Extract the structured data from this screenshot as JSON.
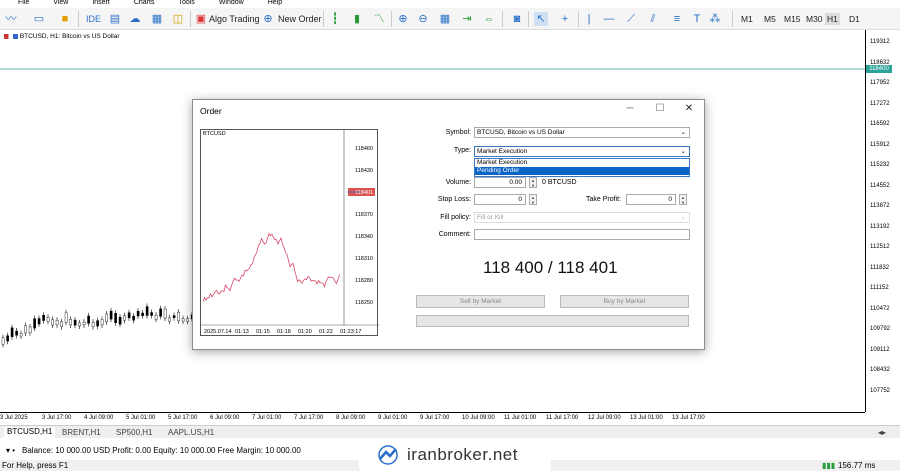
{
  "menu": [
    "File",
    "View",
    "Insert",
    "Charts",
    "Tools",
    "Window",
    "Help"
  ],
  "toolbar": {
    "algo_trading": "Algo Trading",
    "new_order": "New Order",
    "ide": "IDE",
    "timeframes": [
      "M1",
      "M5",
      "M15",
      "M30",
      "H1",
      "D1"
    ],
    "active_timeframe": "H1"
  },
  "chart": {
    "title": "BTCUSD, H1: Bitcoin vs US Dollar",
    "current_price": "118400",
    "price_ticks": [
      "119312",
      "118632",
      "117952",
      "117272",
      "116592",
      "115912",
      "115232",
      "114552",
      "113872",
      "113192",
      "112512",
      "111832",
      "111152",
      "110472",
      "109792",
      "109112",
      "108432",
      "107752"
    ],
    "time_ticks": [
      "3 Jul 2025",
      "3 Jul 17:00",
      "4 Jul 09:00",
      "5 Jul 01:00",
      "5 Jul 17:00",
      "6 Jul 09:00",
      "7 Jul 01:00",
      "7 Jul 17:00",
      "8 Jul 09:00",
      "9 Jul 01:00",
      "9 Jul 17:00",
      "10 Jul 09:00",
      "11 Jul 01:00",
      "11 Jul 17:00",
      "12 Jul 09:00",
      "13 Jul 01:00",
      "13 Jul 17:00"
    ]
  },
  "symbol_tabs": [
    "BTCUSD,H1",
    "BRENT,H1",
    "SP500,H1",
    "AAPL.US,H1"
  ],
  "status": {
    "account": "Balance: 10 000.00 USD  Profit: 0.00  Equity: 10 000.00  Free Margin: 10 000.00",
    "help": "For Help, press F1",
    "ping": "156.77 ms"
  },
  "watermark": "iranbroker.net",
  "order_dialog": {
    "title": "Order",
    "mini_chart": {
      "symbol": "BTCUSD",
      "price_ticks": [
        "118460",
        "118430",
        "118401",
        "118370",
        "118340",
        "118310",
        "118280",
        "118250"
      ],
      "time_ticks": [
        "2025.07.14",
        "01:13",
        "01:15",
        "01:18",
        "01:20",
        "01:22",
        "01:23:17"
      ],
      "current_price": "118401"
    },
    "symbol_label": "Symbol:",
    "symbol_value": "BTCUSD, Bitcoin vs US Dollar",
    "type_label": "Type:",
    "type_value": "Market Execution",
    "type_options": [
      "Market Execution",
      "Pending Order"
    ],
    "type_highlighted": "Pending Order",
    "volume_label": "Volume:",
    "volume_value": "0.00",
    "volume_unit": "0 BTCUSD",
    "stop_loss_label": "Stop Loss:",
    "stop_loss_value": "0",
    "take_profit_label": "Take Profit:",
    "take_profit_value": "0",
    "fill_policy_label": "Fill policy:",
    "fill_policy_value": "Fill or Kill",
    "comment_label": "Comment:",
    "comment_value": "",
    "quote": "118 400 / 118 401",
    "sell_button": "Sell by Market",
    "buy_button": "Buy by Market"
  },
  "colors": {
    "up": "#1a1a1a",
    "accent": "#2aa39a",
    "select": "#0a64c8"
  }
}
